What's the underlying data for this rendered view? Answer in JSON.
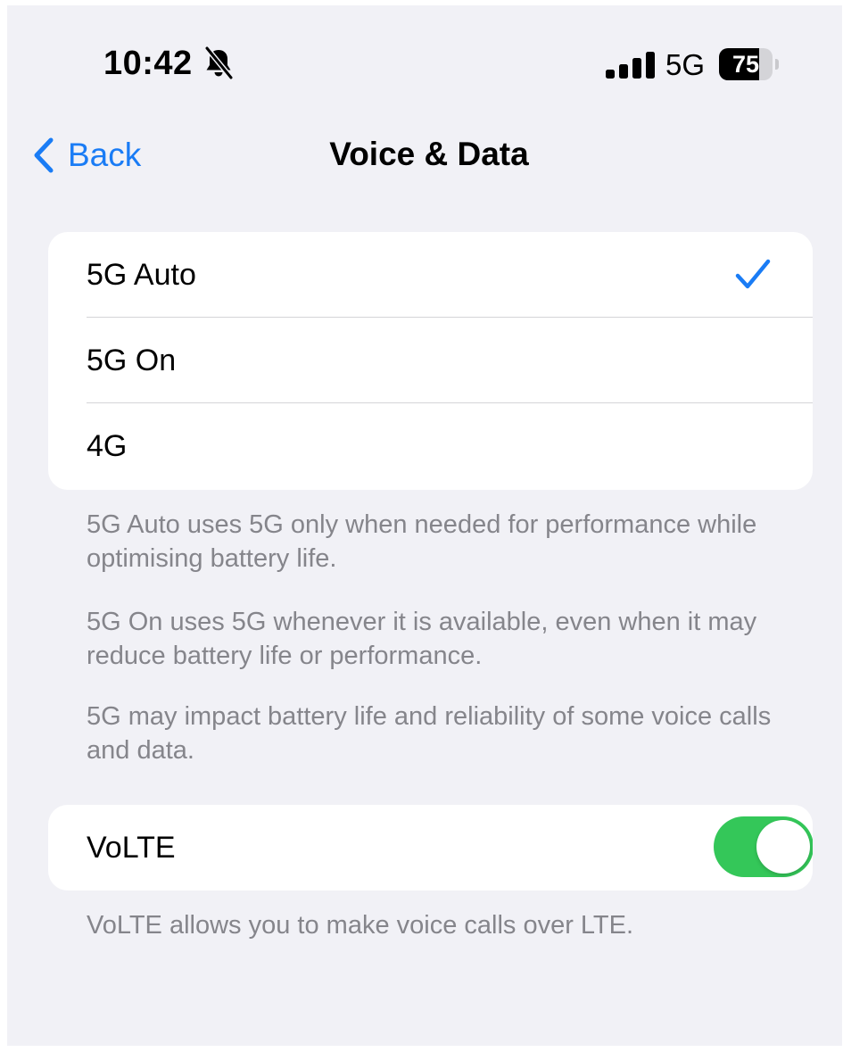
{
  "status_bar": {
    "time": "10:42",
    "silent_icon": "bell-slash-icon",
    "signal_icon": "cellular-signal-icon",
    "network": "5G",
    "battery_level": "75",
    "battery_fraction": 0.75
  },
  "nav": {
    "back_label": "Back",
    "back_icon": "chevron-left-icon",
    "title": "Voice & Data"
  },
  "network_options": [
    {
      "label": "5G Auto",
      "selected": true
    },
    {
      "label": "5G On",
      "selected": false
    },
    {
      "label": "4G",
      "selected": false
    }
  ],
  "network_notes": [
    "5G Auto uses 5G only when needed for performance while optimising battery life.",
    "5G On uses 5G whenever it is available, even when it may reduce battery life or performance.",
    "5G may impact battery life and reliability of some voice calls and data."
  ],
  "volte": {
    "label": "VoLTE",
    "enabled": true,
    "note": "VoLTE allows you to make voice calls over LTE."
  },
  "colors": {
    "accent": "#1a7cf5",
    "toggle_on": "#34c759",
    "background": "#f1f1f6",
    "footnote_text": "#85858b"
  }
}
